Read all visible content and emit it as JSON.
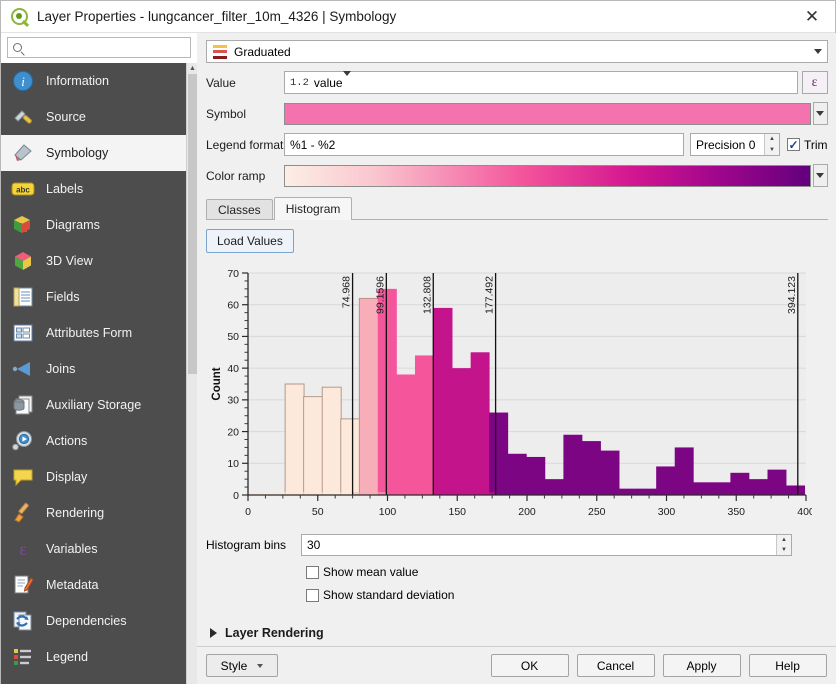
{
  "window": {
    "title": "Layer Properties - lungcancer_filter_10m_4326 | Symbology",
    "logo_icon": "qgis-logo-icon",
    "close_icon": "✕"
  },
  "search": {
    "placeholder": "",
    "value": "",
    "icon": "search-icon"
  },
  "sidebar": {
    "items": [
      {
        "label": "Information",
        "icon": "information-icon",
        "active": false
      },
      {
        "label": "Source",
        "icon": "source-icon",
        "active": false
      },
      {
        "label": "Symbology",
        "icon": "symbology-brush-icon",
        "active": true
      },
      {
        "label": "Labels",
        "icon": "labels-abc-icon",
        "active": false
      },
      {
        "label": "Diagrams",
        "icon": "diagrams-icon",
        "active": false
      },
      {
        "label": "3D View",
        "icon": "3d-view-cube-icon",
        "active": false
      },
      {
        "label": "Fields",
        "icon": "fields-icon",
        "active": false
      },
      {
        "label": "Attributes Form",
        "icon": "attributes-form-icon",
        "active": false
      },
      {
        "label": "Joins",
        "icon": "joins-icon",
        "active": false
      },
      {
        "label": "Auxiliary Storage",
        "icon": "auxiliary-storage-icon",
        "active": false
      },
      {
        "label": "Actions",
        "icon": "actions-gear-icon",
        "active": false
      },
      {
        "label": "Display",
        "icon": "display-balloon-icon",
        "active": false
      },
      {
        "label": "Rendering",
        "icon": "rendering-brush-icon",
        "active": false
      },
      {
        "label": "Variables",
        "icon": "variables-epsilon-icon",
        "active": false
      },
      {
        "label": "Metadata",
        "icon": "metadata-pencil-icon",
        "active": false
      },
      {
        "label": "Dependencies",
        "icon": "dependencies-icon",
        "active": false
      },
      {
        "label": "Legend",
        "icon": "legend-icon",
        "active": false
      }
    ]
  },
  "renderer": {
    "label": "Graduated",
    "icon": "graduated-icon",
    "dropdown_icon": "chevron-down-icon"
  },
  "form": {
    "value_label": "Value",
    "value_prefix": "1.2",
    "value_field": "value",
    "expression_button": "ε",
    "symbol_label": "Symbol",
    "symbol_color": "#f472ad",
    "legend_format_label": "Legend format",
    "legend_format_value": "%1 - %2",
    "precision_label": "Precision 0",
    "trim_label": "Trim",
    "trim_checked": true,
    "color_ramp_label": "Color ramp"
  },
  "tabs": [
    {
      "label": "Classes",
      "active": false
    },
    {
      "label": "Histogram",
      "active": true
    }
  ],
  "histogram_panel": {
    "load_values_label": "Load Values",
    "bins_label": "Histogram bins",
    "bins_value": "30",
    "show_mean_label": "Show mean value",
    "show_mean_checked": false,
    "show_stddev_label": "Show standard deviation",
    "show_stddev_checked": false
  },
  "layer_rendering": {
    "label": "Layer Rendering",
    "expand_icon": "triangle-right-icon"
  },
  "buttons": {
    "style_label": "Style",
    "ok_label": "OK",
    "cancel_label": "Cancel",
    "apply_label": "Apply",
    "help_label": "Help"
  },
  "chart_data": {
    "type": "bar",
    "title": "",
    "xlabel": "",
    "ylabel": "Count",
    "xlim": [
      0,
      400
    ],
    "ylim": [
      0,
      70
    ],
    "xticks": [
      0,
      50,
      100,
      150,
      200,
      250,
      300,
      350,
      400
    ],
    "yticks": [
      0,
      10,
      20,
      30,
      40,
      50,
      60,
      70
    ],
    "grid": true,
    "legend": "none",
    "bin_count": 30,
    "bin_width": 13.3,
    "bins": [
      {
        "x0": 0.0,
        "x1": 13.3,
        "count": 0
      },
      {
        "x0": 13.3,
        "x1": 26.6,
        "count": 0
      },
      {
        "x0": 26.6,
        "x1": 39.9,
        "count": 35
      },
      {
        "x0": 39.9,
        "x1": 53.2,
        "count": 31
      },
      {
        "x0": 53.2,
        "x1": 66.5,
        "count": 34
      },
      {
        "x0": 66.5,
        "x1": 79.8,
        "count": 24
      },
      {
        "x0": 79.8,
        "x1": 93.1,
        "count": 62
      },
      {
        "x0": 93.1,
        "x1": 106.4,
        "count": 65
      },
      {
        "x0": 106.4,
        "x1": 119.7,
        "count": 38
      },
      {
        "x0": 119.7,
        "x1": 133.0,
        "count": 44
      },
      {
        "x0": 133.0,
        "x1": 146.3,
        "count": 59
      },
      {
        "x0": 146.3,
        "x1": 159.6,
        "count": 40
      },
      {
        "x0": 159.6,
        "x1": 172.9,
        "count": 45
      },
      {
        "x0": 172.9,
        "x1": 186.2,
        "count": 26
      },
      {
        "x0": 186.2,
        "x1": 199.5,
        "count": 13
      },
      {
        "x0": 199.5,
        "x1": 212.8,
        "count": 12
      },
      {
        "x0": 212.8,
        "x1": 226.1,
        "count": 5
      },
      {
        "x0": 226.1,
        "x1": 239.4,
        "count": 19
      },
      {
        "x0": 239.4,
        "x1": 252.7,
        "count": 17
      },
      {
        "x0": 252.7,
        "x1": 266.0,
        "count": 14
      },
      {
        "x0": 266.0,
        "x1": 279.3,
        "count": 2
      },
      {
        "x0": 279.3,
        "x1": 292.6,
        "count": 2
      },
      {
        "x0": 292.6,
        "x1": 305.9,
        "count": 9
      },
      {
        "x0": 305.9,
        "x1": 319.2,
        "count": 15
      },
      {
        "x0": 319.2,
        "x1": 332.5,
        "count": 4
      },
      {
        "x0": 332.5,
        "x1": 345.8,
        "count": 4
      },
      {
        "x0": 345.8,
        "x1": 359.1,
        "count": 7
      },
      {
        "x0": 359.1,
        "x1": 372.4,
        "count": 5
      },
      {
        "x0": 372.4,
        "x1": 385.7,
        "count": 8
      },
      {
        "x0": 385.7,
        "x1": 399.0,
        "count": 3
      }
    ],
    "class_breaks": [
      {
        "value": 74.968,
        "label": "74.968"
      },
      {
        "value": 99.1596,
        "label": "99.1596"
      },
      {
        "value": 132.808,
        "label": "132.808"
      },
      {
        "value": 177.492,
        "label": "177.492"
      },
      {
        "value": 394.123,
        "label": "394.123"
      }
    ],
    "class_colors": [
      "#fde9dc",
      "#f7aeb8",
      "#f4559b",
      "#c4148c",
      "#7c0584"
    ],
    "plot_bg": "#ededed",
    "grid_color": "#d8d8d8"
  }
}
